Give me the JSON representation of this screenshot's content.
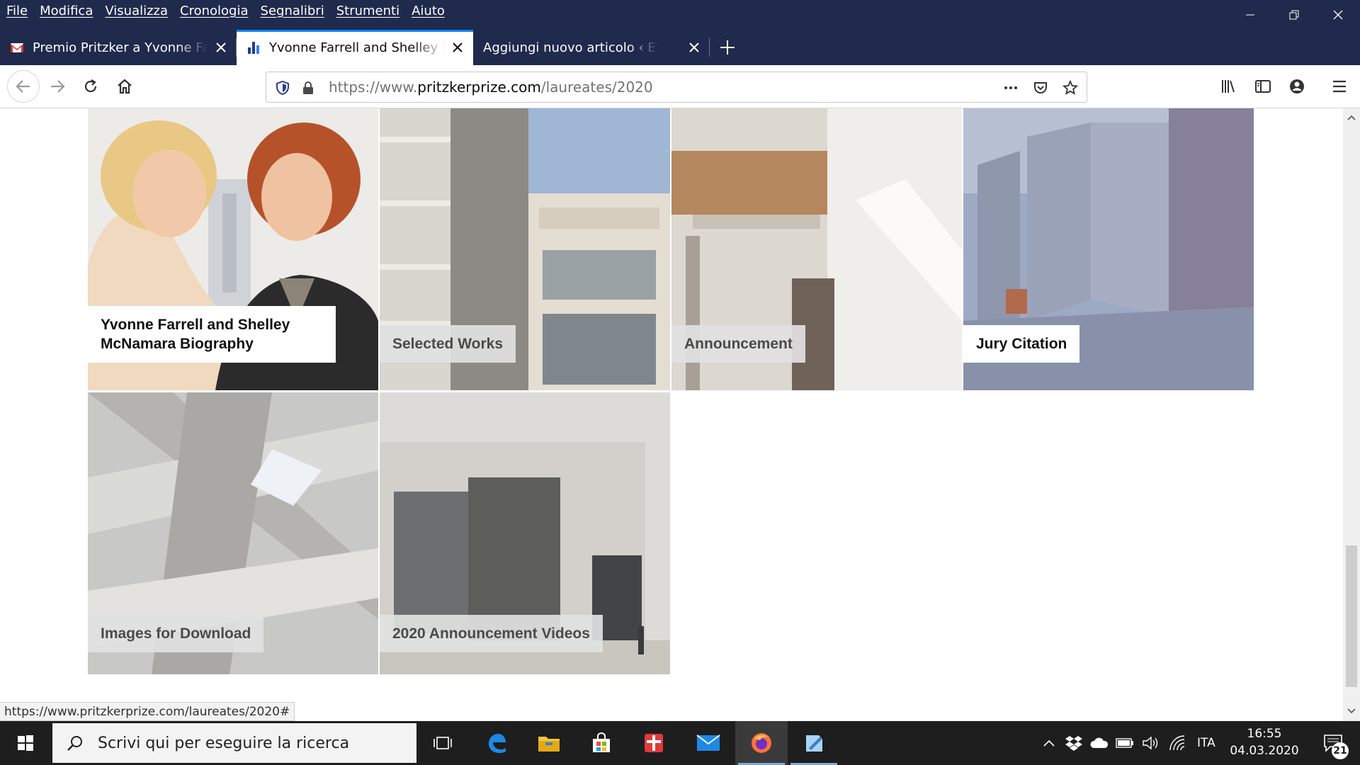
{
  "menu": [
    "File",
    "Modifica",
    "Visualizza",
    "Cronologia",
    "Segnalibri",
    "Strumenti",
    "Aiuto"
  ],
  "tabs": [
    {
      "title": "Premio Pritzker a Yvonne Farrell e",
      "favicon": "gmail-icon"
    },
    {
      "title": "Yvonne Farrell and Shelley McNamara",
      "favicon": "pritzker-icon"
    },
    {
      "title": "Aggiungi nuovo articolo ‹ ETiCinforma",
      "favicon": "none"
    }
  ],
  "url": {
    "prefix": "https://www.",
    "domain": "pritzkerprize.com",
    "path": "/laureates/2020"
  },
  "cards": {
    "bio": "Yvonne Farrell and Shelley McNamara Biography",
    "works": "Selected Works",
    "announcement": "Announcement",
    "jury": "Jury Citation",
    "images": "Images for Download",
    "videos": "2020 Announcement Videos"
  },
  "status_url": "https://www.pritzkerprize.com/laureates/2020#",
  "taskbar": {
    "search_placeholder": "Scrivi qui per eseguire la ricerca",
    "lang": "ITA",
    "time": "16:55",
    "date": "04.03.2020",
    "notifications": "21"
  },
  "colors": {
    "titlebar": "#1f2a4d",
    "active_tab_line": "#0a84ff",
    "taskbar": "#1e1e1e"
  }
}
